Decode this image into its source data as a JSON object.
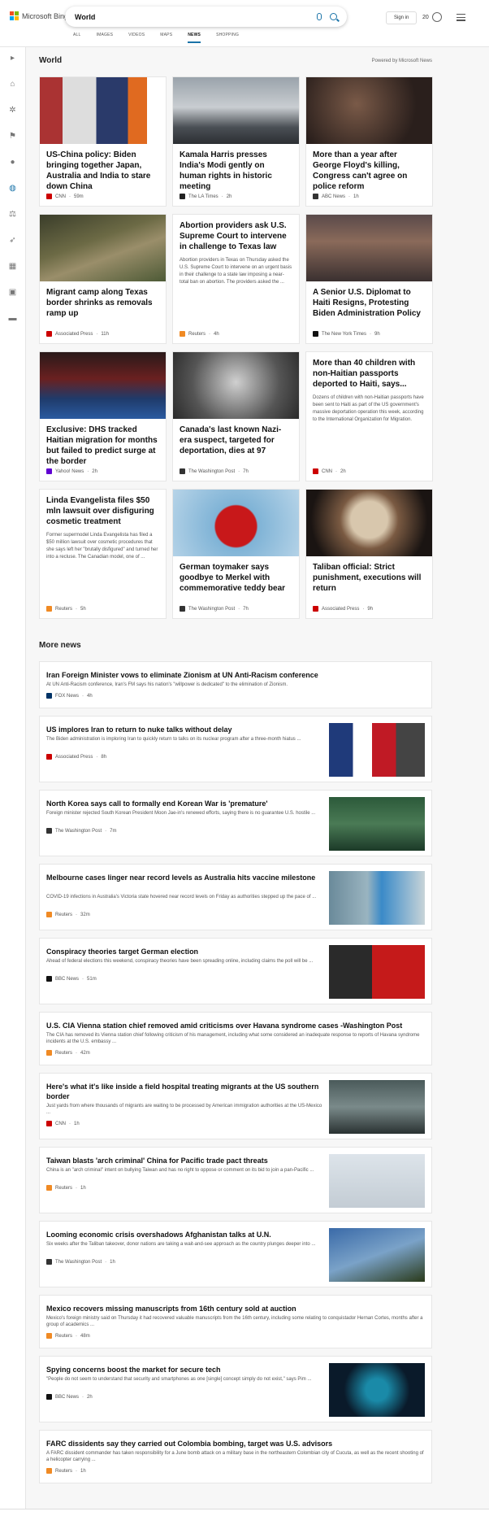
{
  "header": {
    "logo_text": "Microsoft Bing",
    "query": "World",
    "signin": "Sign in",
    "rewards": "20",
    "tabs": [
      "ALL",
      "IMAGES",
      "VIDEOS",
      "MAPS",
      "NEWS",
      "SHOPPING"
    ]
  },
  "section": {
    "title": "World",
    "powered": "Powered by Microsoft News"
  },
  "cards": [
    {
      "title": "US-China policy: Biden bringing together Japan, Australia and India to stare down China",
      "snippet": "",
      "source": "CNN",
      "time": "59m",
      "logo_color": "#cc0000"
    },
    {
      "title": "Kamala Harris presses India's Modi gently on human rights in historic meeting",
      "snippet": "",
      "source": "The LA Times",
      "time": "2h",
      "logo_color": "#222"
    },
    {
      "title": "More than a year after George Floyd's killing, Congress can't agree on police reform",
      "snippet": "",
      "source": "ABC News",
      "time": "1h",
      "logo_color": "#333"
    },
    {
      "title": "Migrant camp along Texas border shrinks as removals ramp up",
      "snippet": "",
      "source": "Associated Press",
      "time": "11h",
      "logo_color": "#c00"
    },
    {
      "title": "Abortion providers ask U.S. Supreme Court to intervene in challenge to Texas law",
      "snippet": "Abortion providers in Texas on Thursday asked the U.S. Supreme Court to intervene on an urgent basis in their challenge to a state law imposing a near-total ban on abortion. The providers asked the ...",
      "source": "Reuters",
      "time": "4h",
      "logo_color": "#f08a24"
    },
    {
      "title": "A Senior U.S. Diplomat to Haiti Resigns, Protesting Biden Administration Policy",
      "snippet": "",
      "source": "The New York Times",
      "time": "9h",
      "logo_color": "#111"
    },
    {
      "title": "Exclusive: DHS tracked Haitian migration for months but failed to predict surge at the border",
      "snippet": "",
      "source": "Yahoo! News",
      "time": "2h",
      "logo_color": "#6001d2"
    },
    {
      "title": "Canada's last known Nazi-era suspect, targeted for deportation, dies at 97",
      "snippet": "",
      "source": "The Washington Post",
      "time": "7h",
      "logo_color": "#333"
    },
    {
      "title": "More than 40 children with non-Haitian passports deported to Haiti, says...",
      "snippet": "Dozens of children with non-Haitian passports have been sent to Haiti as part of the US government's massive deportation operation this week, according to the International Organization for Migration.",
      "source": "CNN",
      "time": "2h",
      "logo_color": "#cc0000"
    },
    {
      "title": "Linda Evangelista files $50 mln lawsuit over disfiguring cosmetic treatment",
      "snippet": "Former supermodel Linda Evangelista has filed a $50 million lawsuit over cosmetic procedures that she says left her \"brutally disfigured\" and turned her into a recluse. The Canadian model, one of ...",
      "source": "Reuters",
      "time": "5h",
      "logo_color": "#f08a24"
    },
    {
      "title": "German toymaker says goodbye to Merkel with commemorative teddy bear",
      "snippet": "",
      "source": "The Washington Post",
      "time": "7h",
      "logo_color": "#333"
    },
    {
      "title": "Taliban official: Strict punishment, executions will return",
      "snippet": "",
      "source": "Associated Press",
      "time": "9h",
      "logo_color": "#c00"
    }
  ],
  "more_title": "More news",
  "more": [
    {
      "title": "Iran Foreign Minister vows to eliminate Zionism at UN Anti-Racism conference",
      "snippet": "At UN Anti-Racism conference, Iran's FM says his nation's \"willpower is dedicated\" to the elimination of Zionism.",
      "source": "FOX News",
      "time": "4h",
      "logo_color": "#003366"
    },
    {
      "title": "US implores Iran to return to nuke talks without delay",
      "snippet": "The Biden administration is imploring Iran to quickly return to talks on its nuclear program after a three-month hiatus ...",
      "source": "Associated Press",
      "time": "8h",
      "logo_color": "#c00"
    },
    {
      "title": "North Korea says call to formally end Korean War is 'premature'",
      "snippet": "Foreign minister rejected South Korean President Moon Jae-in's renewed efforts, saying there is no guarantee U.S. hostile ...",
      "source": "The Washington Post",
      "time": "7m",
      "logo_color": "#333"
    },
    {
      "title": "Melbourne cases linger near record levels as Australia hits vaccine milestone",
      "snippet": "COVID-19 infections in Australia's Victoria state hovered near record levels on Friday as authorities stepped up the pace of ...",
      "source": "Reuters",
      "time": "32m",
      "logo_color": "#f08a24"
    },
    {
      "title": "Conspiracy theories target German election",
      "snippet": "Ahead of federal elections this weekend, conspiracy theories have been spreading online, including claims the poll will be ...",
      "source": "BBC News",
      "time": "51m",
      "logo_color": "#111"
    },
    {
      "title": "U.S. CIA Vienna station chief removed amid criticisms over Havana syndrome cases -Washington Post",
      "snippet": "The CIA has removed its Vienna station chief following criticism of his management, including what some considered an inadequate response to reports of Havana syndrome incidents at the U.S. embassy ...",
      "source": "Reuters",
      "time": "42m",
      "logo_color": "#f08a24"
    },
    {
      "title": "Here's what it's like inside a field hospital treating migrants at the US southern border",
      "snippet": "Just yards from where thousands of migrants are waiting to be processed by American immigration authorities at the US-Mexico ...",
      "source": "CNN",
      "time": "1h",
      "logo_color": "#cc0000"
    },
    {
      "title": "Taiwan blasts 'arch criminal' China for Pacific trade pact threats",
      "snippet": "China is an \"arch criminal\" intent on bullying Taiwan and has no right to oppose or comment on its bid to join a pan-Pacific ...",
      "source": "Reuters",
      "time": "1h",
      "logo_color": "#f08a24"
    },
    {
      "title": "Looming economic crisis overshadows Afghanistan talks at U.N.",
      "snippet": "Six weeks after the Taliban takeover, donor nations are taking a wait-and-see approach as the country plunges deeper into ...",
      "source": "The Washington Post",
      "time": "1h",
      "logo_color": "#333"
    },
    {
      "title": "Mexico recovers missing manuscripts from 16th century sold at auction",
      "snippet": "Mexico's foreign ministry said on Thursday it had recovered valuable manuscripts from the 16th century, including some relating to conquistador Hernan Cortes, months after a group of academics ...",
      "source": "Reuters",
      "time": "48m",
      "logo_color": "#f08a24"
    },
    {
      "title": "Spying concerns boost the market for secure tech",
      "snippet": "\"People do not seem to understand that security and smartphones as one [single] concept simply do not exist,\" says Pim ...",
      "source": "BBC News",
      "time": "2h",
      "logo_color": "#111"
    },
    {
      "title": "FARC dissidents say they carried out Colombia bombing, target was U.S. advisors",
      "snippet": "A FARC dissident commander has taken responsibility for a June bomb attack on a military base in the northeastern Colombian city of Cucuta, as well as the recent shooting of a helicopter carrying ...",
      "source": "Reuters",
      "time": "1h",
      "logo_color": "#f08a24"
    }
  ]
}
